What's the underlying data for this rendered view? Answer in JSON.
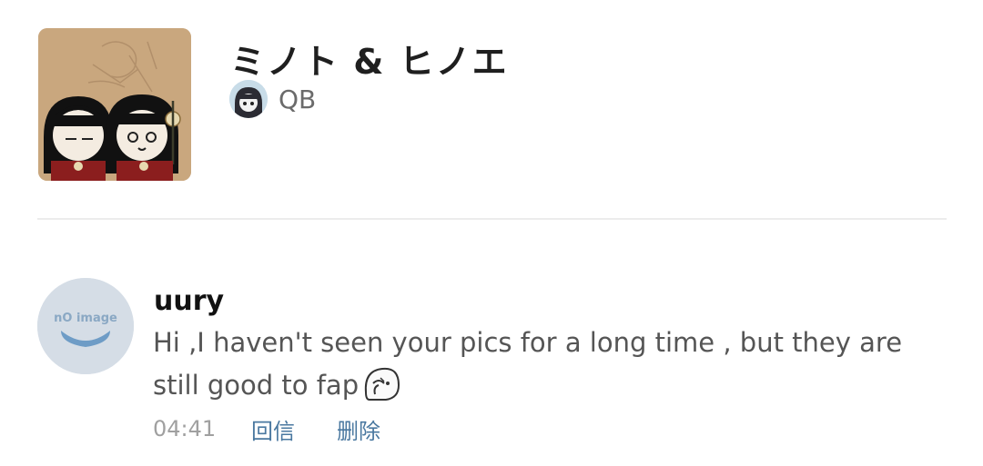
{
  "post": {
    "title": "ミノト & ヒノエ",
    "author": "QB",
    "thumbnail_icon": "artwork-thumbnail",
    "author_avatar_icon": "author-avatar"
  },
  "comment": {
    "username": "uury",
    "text": "Hi ,I haven't seen your pics for a long time , but they are still good to fap",
    "stamp_icon": "sticker-stamp-icon",
    "avatar_placeholder_text": "nO imagе",
    "time": "04:41",
    "reply_label": "回信",
    "delete_label": "删除"
  },
  "colors": {
    "title": "#1f1f1f",
    "meta_gray": "#a0a0a0",
    "link_blue": "#4a78a0",
    "avatar_placeholder": "#d5dde6"
  }
}
